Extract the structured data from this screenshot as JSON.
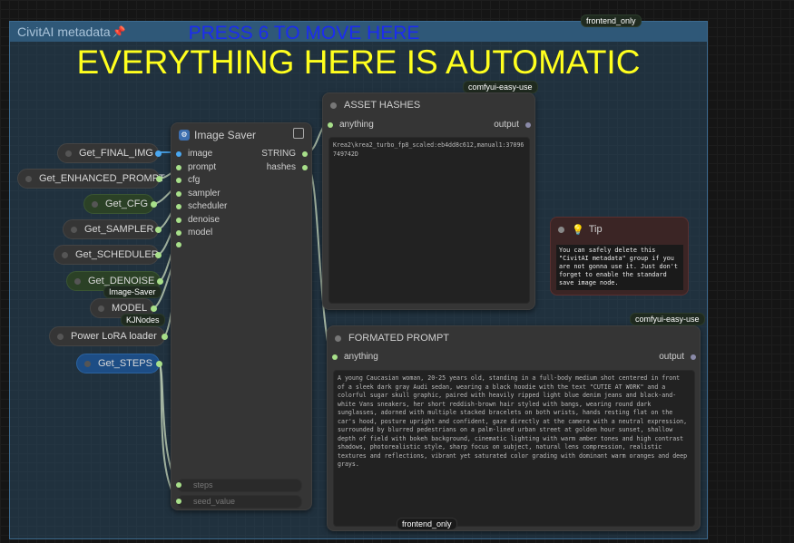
{
  "group": {
    "title": "CivitAI metadata",
    "pin_icon": "pin-icon",
    "header_color": "#2f5878",
    "press_text": "PRESS 6 TO MOVE HERE",
    "automatic_text": "EVERYTHING HERE IS AUTOMATIC"
  },
  "badges": {
    "frontend_top": "frontend_only",
    "easy_use_1": "comfyui-easy-use",
    "easy_use_2": "comfyui-easy-use",
    "image_saver": "Image-Saver",
    "kjnodes": "KJNodes",
    "frontend_bottom": "frontend_only"
  },
  "get_nodes": [
    {
      "label": "Get_FINAL_IMG"
    },
    {
      "label": "Get_ENHANCED_PROMPT"
    },
    {
      "label": "Get_CFG"
    },
    {
      "label": "Get_SAMPLER"
    },
    {
      "label": "Get_SCHEDULER"
    },
    {
      "label": "Get_DENOISE"
    },
    {
      "label": "MODEL"
    },
    {
      "label": "Power LoRA loader"
    },
    {
      "label": "Get_STEPS"
    }
  ],
  "image_saver": {
    "title": "Image Saver",
    "inputs": [
      "image",
      "prompt",
      "cfg",
      "sampler",
      "scheduler",
      "denoise",
      "model"
    ],
    "outputs": [
      "STRING",
      "hashes"
    ],
    "widgets": [
      "steps",
      "seed_value"
    ]
  },
  "asset_hashes": {
    "title": "ASSET HASHES",
    "input": "anything",
    "output": "output",
    "text": "Krea2\\krea2_turbo_fp8_scaled:eb4dd8c612,manual1:37096749742D"
  },
  "formated_prompt": {
    "title": "FORMATED PROMPT",
    "input": "anything",
    "output": "output",
    "text": "A young Caucasian woman, 20-25 years old, standing in a full-body medium shot centered in front of a sleek dark gray Audi sedan, wearing a black hoodie with the text \"CUTIE AT WORK\" and a colorful sugar skull graphic, paired with heavily ripped light blue denim jeans and black-and-white Vans sneakers, her short reddish-brown hair styled with bangs, wearing round dark sunglasses, adorned with multiple stacked bracelets on both wrists, hands resting flat on the car's hood, posture upright and confident, gaze directly at the camera with a neutral expression, surrounded by blurred pedestrians on a palm-lined urban street at golden hour sunset, shallow depth of field with bokeh background, cinematic lighting with warm amber tones and high contrast shadows, photorealistic style, sharp focus on subject, natural lens compression, realistic textures and reflections, vibrant yet saturated color grading with dominant warm oranges and deep grays."
  },
  "tip": {
    "title": "Tip",
    "icon": "lightbulb-icon",
    "text": "You can safely delete this \"CivitAI metadata\" group if you are not gonna use it. Just don't forget to enable the standard save image node."
  }
}
